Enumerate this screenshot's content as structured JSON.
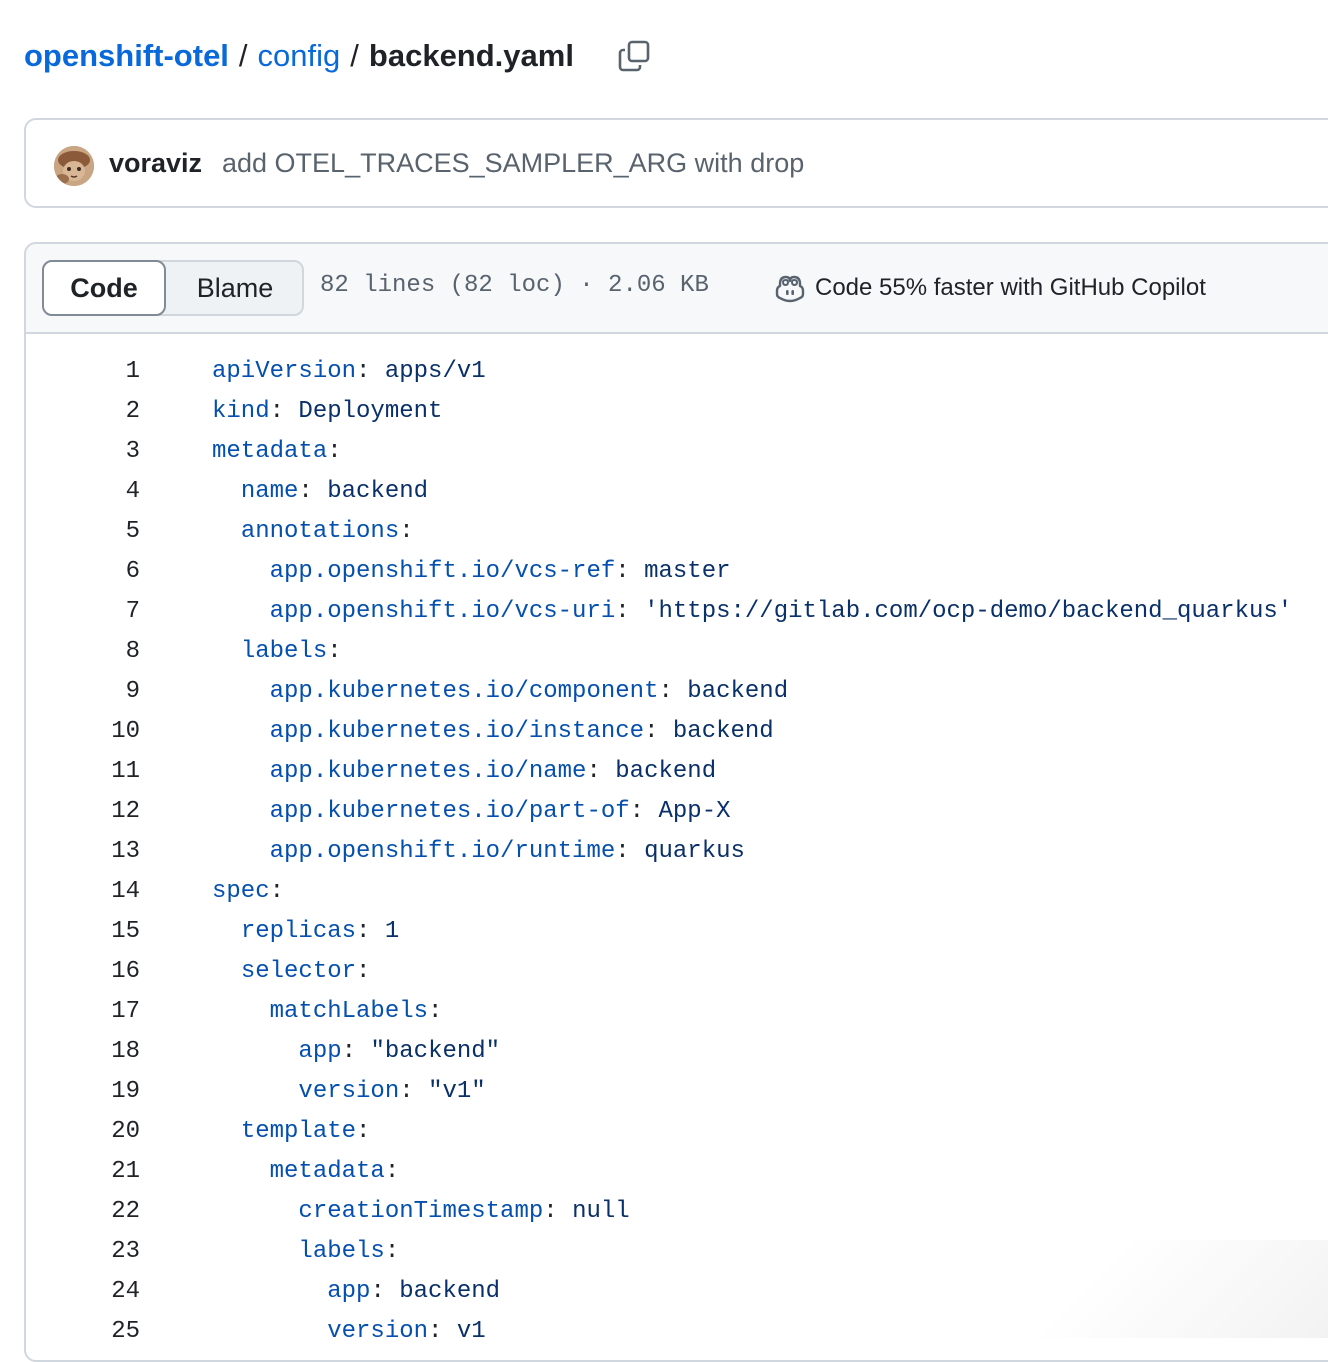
{
  "breadcrumb": {
    "root": "openshift-otel",
    "folder": "config",
    "separator": "/",
    "file": "backend.yaml"
  },
  "copy_icon": "copy-icon",
  "commit": {
    "author": "voraviz",
    "message": "add OTEL_TRACES_SAMPLER_ARG with drop"
  },
  "file_header": {
    "tabs": [
      "Code",
      "Blame"
    ],
    "active_tab": "Code",
    "info": "82 lines (82 loc) · 2.06 KB",
    "copilot_text": "Code 55% faster with GitHub Copilot",
    "copilot_icon": "copilot-icon"
  },
  "colors": {
    "link": "#0969da",
    "key": "#0550ae",
    "value": "#0a3069",
    "border": "#d0d7de"
  },
  "code_lines": [
    {
      "n": "1",
      "indent": "",
      "key": "apiVersion",
      "value": "apps/v1"
    },
    {
      "n": "2",
      "indent": "",
      "key": "kind",
      "value": "Deployment"
    },
    {
      "n": "3",
      "indent": "",
      "key": "metadata",
      "value": ""
    },
    {
      "n": "4",
      "indent": "  ",
      "key": "name",
      "value": "backend"
    },
    {
      "n": "5",
      "indent": "  ",
      "key": "annotations",
      "value": ""
    },
    {
      "n": "6",
      "indent": "    ",
      "key": "app.openshift.io/vcs-ref",
      "value": "master"
    },
    {
      "n": "7",
      "indent": "    ",
      "key": "app.openshift.io/vcs-uri",
      "value": "'https://gitlab.com/ocp-demo/backend_quarkus'"
    },
    {
      "n": "8",
      "indent": "  ",
      "key": "labels",
      "value": ""
    },
    {
      "n": "9",
      "indent": "    ",
      "key": "app.kubernetes.io/component",
      "value": "backend"
    },
    {
      "n": "10",
      "indent": "    ",
      "key": "app.kubernetes.io/instance",
      "value": "backend"
    },
    {
      "n": "11",
      "indent": "    ",
      "key": "app.kubernetes.io/name",
      "value": "backend"
    },
    {
      "n": "12",
      "indent": "    ",
      "key": "app.kubernetes.io/part-of",
      "value": "App-X"
    },
    {
      "n": "13",
      "indent": "    ",
      "key": "app.openshift.io/runtime",
      "value": "quarkus"
    },
    {
      "n": "14",
      "indent": "",
      "key": "spec",
      "value": ""
    },
    {
      "n": "15",
      "indent": "  ",
      "key": "replicas",
      "value": "1"
    },
    {
      "n": "16",
      "indent": "  ",
      "key": "selector",
      "value": ""
    },
    {
      "n": "17",
      "indent": "    ",
      "key": "matchLabels",
      "value": ""
    },
    {
      "n": "18",
      "indent": "      ",
      "key": "app",
      "value": "\"backend\""
    },
    {
      "n": "19",
      "indent": "      ",
      "key": "version",
      "value": "\"v1\""
    },
    {
      "n": "20",
      "indent": "  ",
      "key": "template",
      "value": ""
    },
    {
      "n": "21",
      "indent": "    ",
      "key": "metadata",
      "value": ""
    },
    {
      "n": "22",
      "indent": "      ",
      "key": "creationTimestamp",
      "value": "null"
    },
    {
      "n": "23",
      "indent": "      ",
      "key": "labels",
      "value": ""
    },
    {
      "n": "24",
      "indent": "        ",
      "key": "app",
      "value": "backend"
    },
    {
      "n": "25",
      "indent": "        ",
      "key": "version",
      "value": "v1"
    }
  ]
}
